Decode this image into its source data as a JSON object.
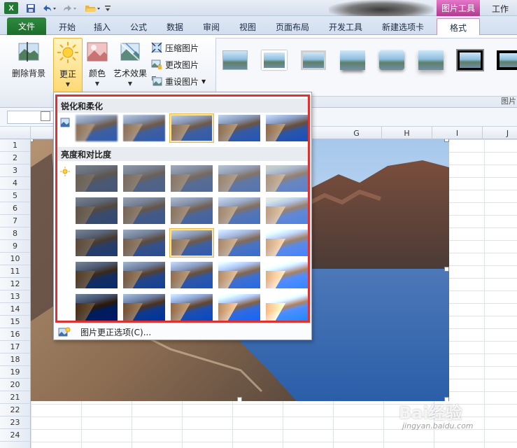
{
  "titlebar": {
    "app_logo": "X",
    "picture_tools_tab": "图片工具",
    "title_fragment": "工作",
    "icons": [
      "save-icon",
      "undo-icon",
      "redo-icon",
      "open-folder-icon",
      "customize-quick-access-icon"
    ]
  },
  "tabs": [
    {
      "label": "文件"
    },
    {
      "label": "开始"
    },
    {
      "label": "插入"
    },
    {
      "label": "公式"
    },
    {
      "label": "数据"
    },
    {
      "label": "审阅"
    },
    {
      "label": "视图"
    },
    {
      "label": "页面布局"
    },
    {
      "label": "开发工具"
    },
    {
      "label": "新建选项卡"
    },
    {
      "label": "格式"
    }
  ],
  "ribbon": {
    "remove_background": "删除背景",
    "corrections": "更正",
    "color": "颜色",
    "artistic_effects": "艺术效果",
    "compress": "压缩图片",
    "change": "更改图片",
    "reset": "重设图片",
    "group_label_fragment": "图片"
  },
  "columns": [
    "G",
    "H",
    "I",
    "J"
  ],
  "rows": [
    "1",
    "2",
    "3",
    "4",
    "5",
    "6",
    "7",
    "8",
    "9",
    "10",
    "11",
    "12",
    "13",
    "14",
    "15",
    "16",
    "17",
    "18",
    "19",
    "20",
    "21",
    "22",
    "23",
    "24"
  ],
  "dropdown": {
    "section1": "锐化和柔化",
    "section2": "亮度和对比度",
    "options_label": "图片更正选项(C)..."
  },
  "watermark": {
    "logo": "Bai经验",
    "url": "jingyan.baidu.com"
  },
  "colors": {
    "file_tab": "#1d6e2b",
    "picture_tools": "#b13a8f",
    "highlight": "#fde5a4",
    "red_outline": "#e03030"
  }
}
